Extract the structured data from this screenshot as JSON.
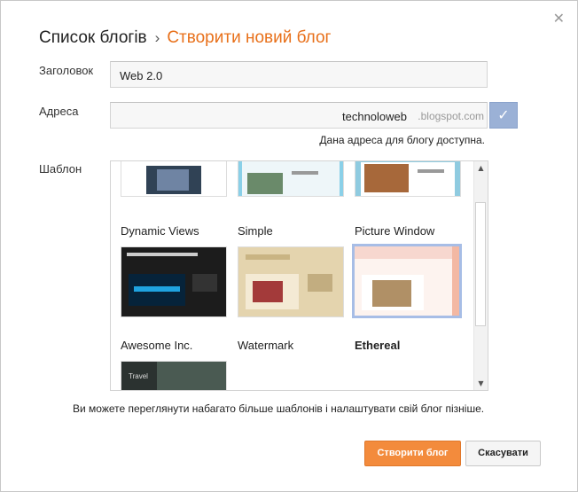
{
  "dialog": {
    "close_icon": "close-icon"
  },
  "breadcrumb": {
    "parent": "Список блогів",
    "separator": "›",
    "current": "Створити новий блог"
  },
  "form": {
    "title_label": "Заголовок",
    "title_value": "Web 2.0",
    "address_label": "Адреса",
    "address_value": "technoloweb",
    "address_suffix": ".blogspot.com",
    "address_status": "Дана адреса для блогу доступна.",
    "template_label": "Шаблон"
  },
  "templates": [
    {
      "name": "Dynamic Views",
      "selected": false
    },
    {
      "name": "Simple",
      "selected": false
    },
    {
      "name": "Picture Window",
      "selected": false
    },
    {
      "name": "Awesome Inc.",
      "selected": false
    },
    {
      "name": "Watermark",
      "selected": false
    },
    {
      "name": "Ethereal",
      "selected": true
    },
    {
      "name": "Travel",
      "selected": false
    }
  ],
  "note": "Ви можете переглянути набагато більше шаблонів і налаштувати свій блог пізніше.",
  "buttons": {
    "create": "Створити блог",
    "cancel": "Скасувати"
  },
  "colors": {
    "accent": "#e8701a",
    "primary_button": "#f38b3c",
    "check_button": "#9bb1d6",
    "selected_border": "#a7bde6"
  }
}
